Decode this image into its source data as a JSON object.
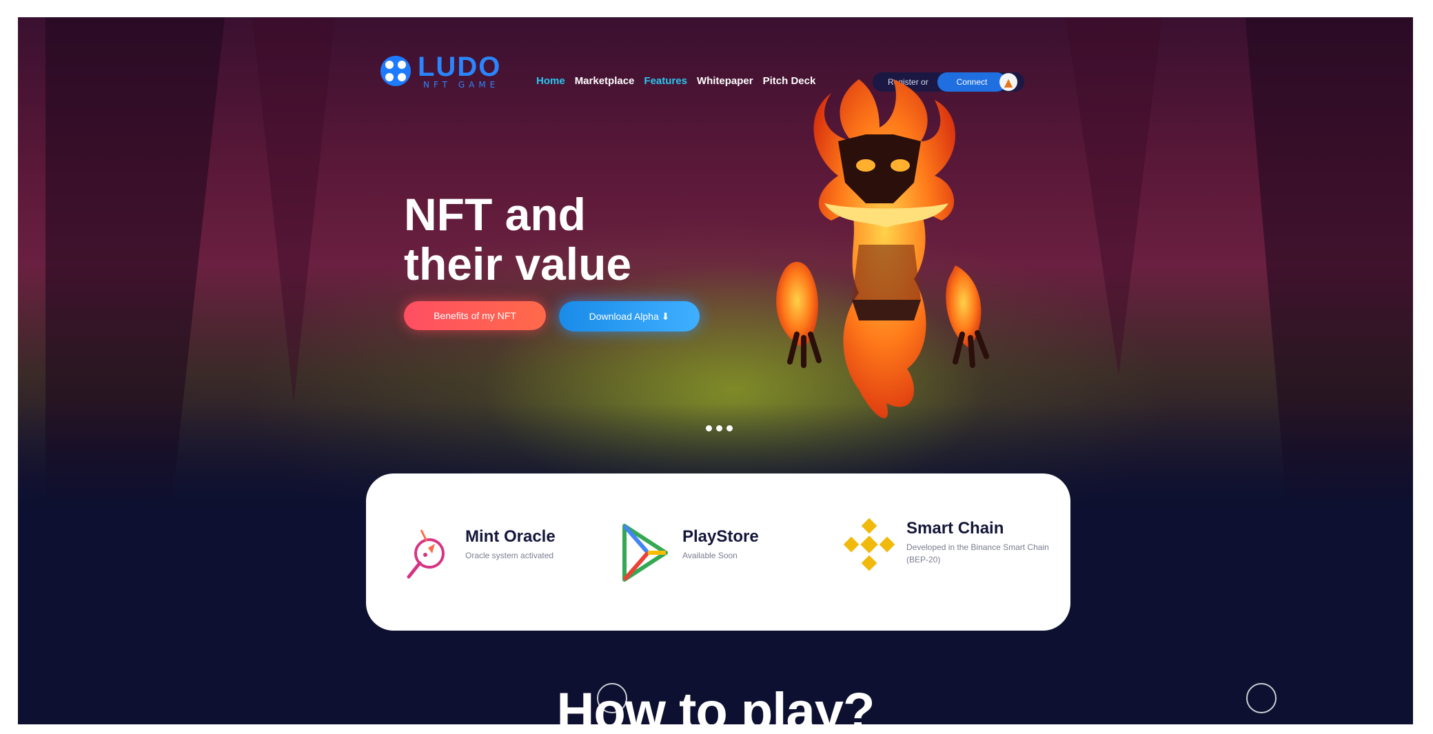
{
  "logo": {
    "text": "LUDO",
    "sub": "NFT GAME"
  },
  "nav": [
    {
      "label": "Home",
      "active": true
    },
    {
      "label": "Marketplace",
      "active": false
    },
    {
      "label": "Features",
      "active": true
    },
    {
      "label": "Whitepaper",
      "active": false
    },
    {
      "label": "Pitch Deck",
      "active": false
    }
  ],
  "auth": {
    "register": "Register or",
    "connect": "Connect",
    "wallet_icon": "metamask-fox-icon"
  },
  "hero": {
    "title_line1": "NFT and",
    "title_line2": "their value",
    "btn_benefits": "Benefits of my NFT",
    "btn_download": "Download Alpha ⬇"
  },
  "features": [
    {
      "icon": "oracle-icon",
      "title": "Mint Oracle",
      "desc": "Oracle system activated"
    },
    {
      "icon": "playstore-icon",
      "title": "PlayStore",
      "desc": "Available Soon"
    },
    {
      "icon": "binance-icon",
      "title": "Smart Chain",
      "desc": "Developed in the Binance Smart Chain (BEP-20)"
    }
  ],
  "section": {
    "how_to_play": "How to play?"
  },
  "colors": {
    "accent_blue": "#1e7bff",
    "accent_cyan": "#29c7f0",
    "accent_red": "#ff4f63",
    "bg_dark": "#0d1030",
    "binance_gold": "#f0b90b"
  }
}
